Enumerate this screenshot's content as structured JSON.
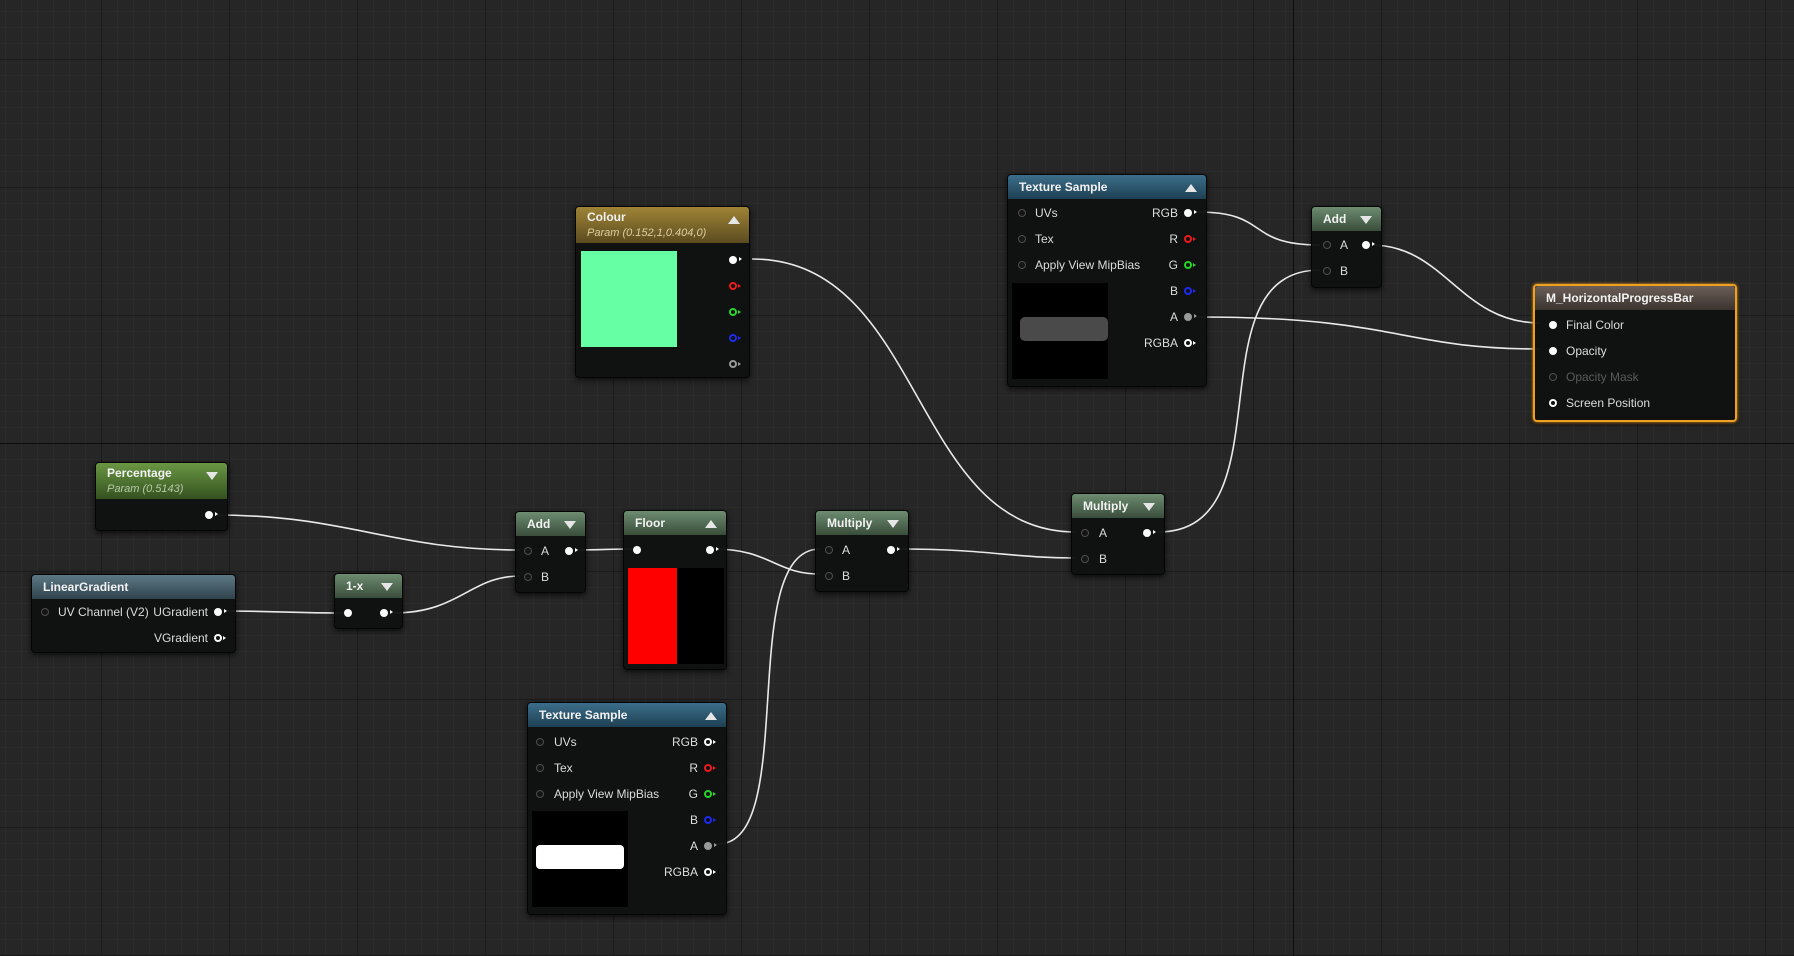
{
  "graph": {
    "nodes": {
      "colour": {
        "title": "Colour",
        "subtitle": "Param (0.152,1,0.404,0)",
        "swatch_color": "#66ffa3"
      },
      "texture_sample_top": {
        "title": "Texture Sample",
        "inputs": [
          "UVs",
          "Tex",
          "Apply View MipBias"
        ],
        "outputs": [
          "RGB",
          "R",
          "G",
          "B",
          "A",
          "RGBA"
        ]
      },
      "add_top": {
        "title": "Add",
        "inputs": [
          "A",
          "B"
        ]
      },
      "result": {
        "title": "M_HorizontalProgressBar",
        "inputs": [
          "Final Color",
          "Opacity",
          "Opacity Mask",
          "Screen Position"
        ]
      },
      "percentage": {
        "title": "Percentage",
        "subtitle": "Param (0.5143)"
      },
      "linear_gradient": {
        "title": "LinearGradient",
        "input": "UV Channel (V2)",
        "outputs": [
          "UGradient",
          "VGradient"
        ]
      },
      "one_minus_x": {
        "title": "1-x"
      },
      "add_mid": {
        "title": "Add",
        "inputs": [
          "A",
          "B"
        ]
      },
      "floor": {
        "title": "Floor",
        "preview_colors": [
          "#ff0000",
          "#000000"
        ]
      },
      "multiply_mid": {
        "title": "Multiply",
        "inputs": [
          "A",
          "B"
        ]
      },
      "multiply_right": {
        "title": "Multiply",
        "inputs": [
          "A",
          "B"
        ]
      },
      "texture_sample_bottom": {
        "title": "Texture Sample",
        "inputs": [
          "UVs",
          "Tex",
          "Apply View MipBias"
        ],
        "outputs": [
          "RGB",
          "R",
          "G",
          "B",
          "A",
          "RGBA"
        ]
      }
    }
  }
}
